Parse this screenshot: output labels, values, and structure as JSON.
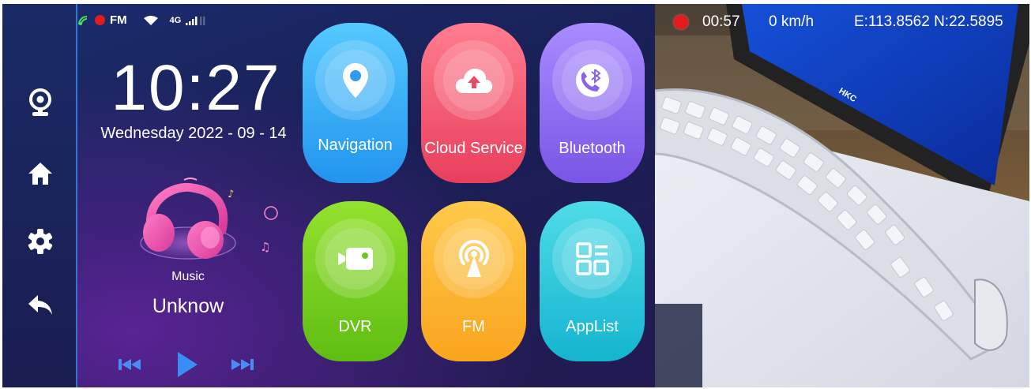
{
  "status_bar": {
    "radio_label": "FM",
    "network_label": "4G"
  },
  "clock": {
    "time": "10:27",
    "date": "Wednesday  2022 - 09 - 14"
  },
  "music": {
    "title": "Music",
    "track": "Unknow"
  },
  "apps": [
    {
      "label": "Navigation",
      "color": "#2a9cf0"
    },
    {
      "label": "Cloud Service",
      "color": "#f04a66"
    },
    {
      "label": "Bluetooth",
      "color": "#8a63ec"
    },
    {
      "label": "DVR",
      "color": "#7ad020"
    },
    {
      "label": "FM",
      "color": "#fbb22a"
    },
    {
      "label": "AppList",
      "color": "#1cc2d8"
    }
  ],
  "camera": {
    "rec_time": "00:57",
    "speed": "0 km/h",
    "coordinates": "E:113.8562 N:22.5895",
    "monitor_brand": "HKC"
  },
  "colors": {
    "accent": "#2f77d4",
    "record": "#e21b1b"
  }
}
